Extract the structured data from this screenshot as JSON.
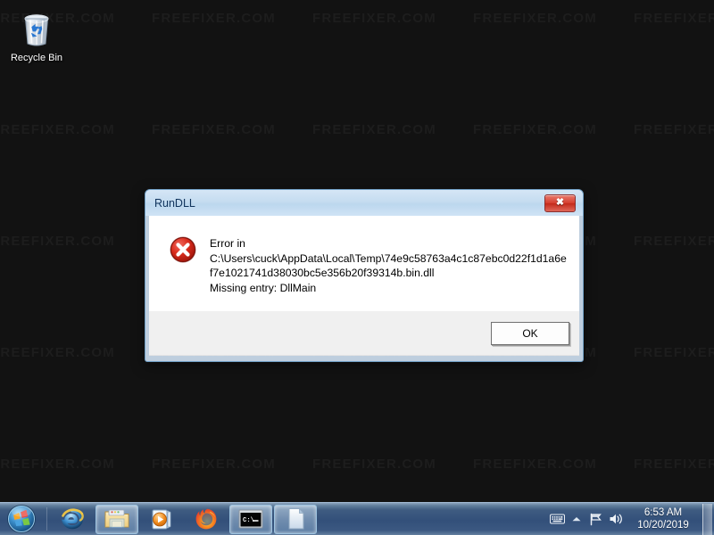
{
  "desktop": {
    "watermark_text": "FREEFIXER.COM",
    "background_color": "#121212",
    "icons": [
      {
        "name": "recycle-bin",
        "label": "Recycle Bin"
      }
    ]
  },
  "dialog": {
    "title": "RunDLL",
    "close_label": "✕",
    "icon": "error-icon",
    "message_line1": "Error in",
    "message_path": "C:\\Users\\cuck\\AppData\\Local\\Temp\\74e9c58763a4c1c87ebc0d22f1d1a6ef7e1021741d38030bc5e356b20f39314b.bin.dll",
    "message_line3": "Missing entry: DllMain",
    "ok_label": "OK",
    "accent_color": "#c32a1b",
    "titlebar_color": "#c5dcf0"
  },
  "taskbar": {
    "start_label": "Start",
    "items": [
      {
        "name": "internet-explorer",
        "label": "Internet Explorer",
        "active": false
      },
      {
        "name": "file-explorer",
        "label": "Windows Explorer",
        "active": true
      },
      {
        "name": "media-player",
        "label": "Windows Media Player",
        "active": false
      },
      {
        "name": "firefox",
        "label": "Mozilla Firefox",
        "active": false
      },
      {
        "name": "command-prompt",
        "label": "Command Prompt",
        "active": true
      },
      {
        "name": "document-window",
        "label": "Document",
        "active": true
      }
    ],
    "tray": [
      {
        "name": "keyboard-icon",
        "label": "Keyboard layout"
      },
      {
        "name": "show-hidden-icons-icon",
        "label": "Show hidden icons"
      },
      {
        "name": "network-icon",
        "label": "Network"
      },
      {
        "name": "volume-icon",
        "label": "Volume"
      }
    ],
    "clock": {
      "time": "6:53 AM",
      "date": "10/20/2019"
    }
  }
}
